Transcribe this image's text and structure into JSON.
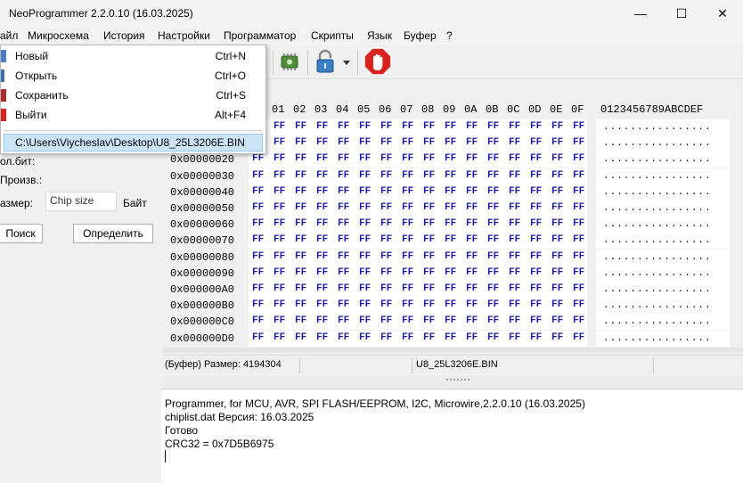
{
  "window": {
    "title": "NeoProgrammer 2.2.0.10 (16.03.2025)",
    "minimize_glyph": "—",
    "maximize_glyph": "☐",
    "close_glyph": "✕"
  },
  "menubar": {
    "items": [
      "айл",
      "Микросхема",
      "История",
      "Настройки",
      "Программатор",
      "Скрипты",
      "Язык",
      "Буфер",
      "?"
    ]
  },
  "file_menu": {
    "items": [
      {
        "label": "Новый",
        "shortcut": "Ctrl+N",
        "icon": "new-file-icon"
      },
      {
        "label": "Открыть",
        "shortcut": "Ctrl+O",
        "icon": "open-folder-icon"
      },
      {
        "label": "Сохранить",
        "shortcut": "Ctrl+S",
        "icon": "save-icon"
      },
      {
        "label": "Выйти",
        "shortcut": "Alt+F4",
        "icon": "exit-icon"
      }
    ],
    "recent_file": "C:\\Users\\Viycheslav\\Desktop\\U8_25L3206E.BIN"
  },
  "toolbar": {
    "icons": [
      "chip-icon",
      "lock-icon",
      "stop-icon"
    ]
  },
  "left_panel": {
    "label_protection": "ол.бит:",
    "label_manufacturer": "Произв.:",
    "label_size": "азмер:",
    "size_placeholder": "Chip size",
    "size_unit": "Байт",
    "search_button": "Поиск",
    "detect_button": "Определить"
  },
  "hex_editor": {
    "header_columns": [
      "01",
      "02",
      "03",
      "04",
      "05",
      "06",
      "07",
      "08",
      "09",
      "0A",
      "0B",
      "0C",
      "0D",
      "0E",
      "0F"
    ],
    "ascii_header": "0123456789ABCDEF",
    "rows": [
      {
        "addr": "",
        "bytes": [
          "FF",
          "FF",
          "FF",
          "FF",
          "FF",
          "FF",
          "FF",
          "FF",
          "FF",
          "FF",
          "FF",
          "FF",
          "FF",
          "FF",
          "FF",
          "FF"
        ],
        "ascii": "................"
      },
      {
        "addr": "",
        "bytes": [
          "FF",
          "FF",
          "FF",
          "FF",
          "FF",
          "FF",
          "FF",
          "FF",
          "FF",
          "FF",
          "FF",
          "FF",
          "FF",
          "FF",
          "FF",
          "FF"
        ],
        "ascii": "................"
      },
      {
        "addr": "0x00000020",
        "bytes": [
          "FF",
          "FF",
          "FF",
          "FF",
          "FF",
          "FF",
          "FF",
          "FF",
          "FF",
          "FF",
          "FF",
          "FF",
          "FF",
          "FF",
          "FF",
          "FF"
        ],
        "ascii": "................"
      },
      {
        "addr": "0x00000030",
        "bytes": [
          "FF",
          "FF",
          "FF",
          "FF",
          "FF",
          "FF",
          "FF",
          "FF",
          "FF",
          "FF",
          "FF",
          "FF",
          "FF",
          "FF",
          "FF",
          "FF"
        ],
        "ascii": "................"
      },
      {
        "addr": "0x00000040",
        "bytes": [
          "FF",
          "FF",
          "FF",
          "FF",
          "FF",
          "FF",
          "FF",
          "FF",
          "FF",
          "FF",
          "FF",
          "FF",
          "FF",
          "FF",
          "FF",
          "FF"
        ],
        "ascii": "................"
      },
      {
        "addr": "0x00000050",
        "bytes": [
          "FF",
          "FF",
          "FF",
          "FF",
          "FF",
          "FF",
          "FF",
          "FF",
          "FF",
          "FF",
          "FF",
          "FF",
          "FF",
          "FF",
          "FF",
          "FF"
        ],
        "ascii": "................"
      },
      {
        "addr": "0x00000060",
        "bytes": [
          "FF",
          "FF",
          "FF",
          "FF",
          "FF",
          "FF",
          "FF",
          "FF",
          "FF",
          "FF",
          "FF",
          "FF",
          "FF",
          "FF",
          "FF",
          "FF"
        ],
        "ascii": "................"
      },
      {
        "addr": "0x00000070",
        "bytes": [
          "FF",
          "FF",
          "FF",
          "FF",
          "FF",
          "FF",
          "FF",
          "FF",
          "FF",
          "FF",
          "FF",
          "FF",
          "FF",
          "FF",
          "FF",
          "FF"
        ],
        "ascii": "................"
      },
      {
        "addr": "0x00000080",
        "bytes": [
          "FF",
          "FF",
          "FF",
          "FF",
          "FF",
          "FF",
          "FF",
          "FF",
          "FF",
          "FF",
          "FF",
          "FF",
          "FF",
          "FF",
          "FF",
          "FF"
        ],
        "ascii": "................"
      },
      {
        "addr": "0x00000090",
        "bytes": [
          "FF",
          "FF",
          "FF",
          "FF",
          "FF",
          "FF",
          "FF",
          "FF",
          "FF",
          "FF",
          "FF",
          "FF",
          "FF",
          "FF",
          "FF",
          "FF"
        ],
        "ascii": "................"
      },
      {
        "addr": "0x000000A0",
        "bytes": [
          "FF",
          "FF",
          "FF",
          "FF",
          "FF",
          "FF",
          "FF",
          "FF",
          "FF",
          "FF",
          "FF",
          "FF",
          "FF",
          "FF",
          "FF",
          "FF"
        ],
        "ascii": "................"
      },
      {
        "addr": "0x000000B0",
        "bytes": [
          "FF",
          "FF",
          "FF",
          "FF",
          "FF",
          "FF",
          "FF",
          "FF",
          "FF",
          "FF",
          "FF",
          "FF",
          "FF",
          "FF",
          "FF",
          "FF"
        ],
        "ascii": "................"
      },
      {
        "addr": "0x000000C0",
        "bytes": [
          "FF",
          "FF",
          "FF",
          "FF",
          "FF",
          "FF",
          "FF",
          "FF",
          "FF",
          "FF",
          "FF",
          "FF",
          "FF",
          "FF",
          "FF",
          "FF"
        ],
        "ascii": "................"
      },
      {
        "addr": "0x000000D0",
        "bytes": [
          "FF",
          "FF",
          "FF",
          "FF",
          "FF",
          "FF",
          "FF",
          "FF",
          "FF",
          "FF",
          "FF",
          "FF",
          "FF",
          "FF",
          "FF",
          "FF"
        ],
        "ascii": "................"
      }
    ]
  },
  "status": {
    "buffer_size": "(Буфер) Размер: 4194304",
    "filename": "U8_25L3206E.BIN"
  },
  "log": {
    "lines": [
      "Programmer, for MCU, AVR, SPI FLASH/EEPROM, I2C, Microwire,2.2.0.10 (16.03.2025)",
      "chiplist.dat Версия: 16.03.2025",
      "Готово",
      "CRC32 = 0x7D5B6975"
    ]
  },
  "colors": {
    "hex_byte": "#1a1aa6",
    "menu_highlight": "#cce4f7",
    "stop_red": "#d9231f"
  }
}
